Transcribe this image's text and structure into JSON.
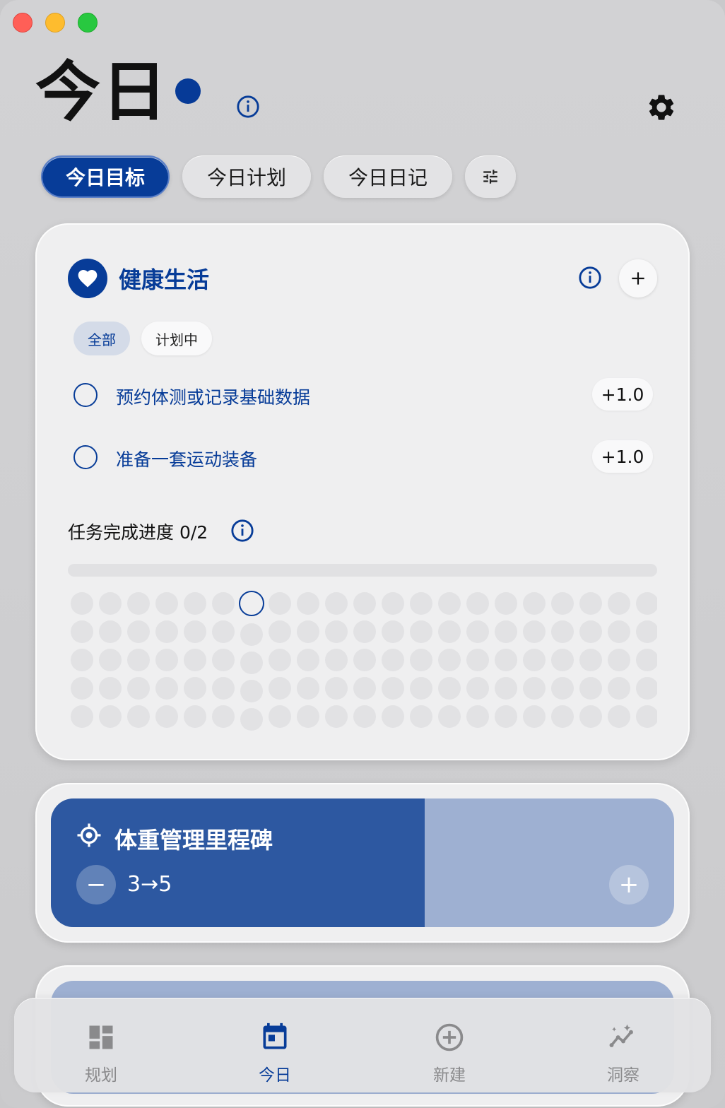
{
  "header": {
    "title": "今日"
  },
  "tabs": [
    {
      "label": "今日目标",
      "active": true
    },
    {
      "label": "今日计划",
      "active": false
    },
    {
      "label": "今日日记",
      "active": false
    }
  ],
  "goal_card": {
    "category": "健康生活",
    "filters": [
      {
        "label": "全部",
        "active": true
      },
      {
        "label": "计划中",
        "active": false
      }
    ],
    "tasks": [
      {
        "label": "预约体测或记录基础数据",
        "score": "+1.0",
        "done": false
      },
      {
        "label": "准备一套运动装备",
        "score": "+1.0",
        "done": false
      }
    ],
    "progress_label": "任务完成进度 0/2",
    "progress_fraction": 0,
    "dot_grid": {
      "rows": 5,
      "cols": 21,
      "current_col": 6
    }
  },
  "milestone": {
    "title": "体重管理里程碑",
    "range": "3→5",
    "minus_label": "−",
    "plus_label": "+",
    "progress_fraction": 0.6
  },
  "colors": {
    "accent": "#073c98",
    "milestone_fill": "#2d58a1",
    "milestone_track": "#9eb0d2"
  },
  "tabbar": [
    {
      "label": "规划",
      "icon": "dashboard-icon",
      "active": false
    },
    {
      "label": "今日",
      "icon": "calendar-icon",
      "active": true
    },
    {
      "label": "新建",
      "icon": "add-circle-icon",
      "active": false
    },
    {
      "label": "洞察",
      "icon": "insights-icon",
      "active": false
    }
  ]
}
